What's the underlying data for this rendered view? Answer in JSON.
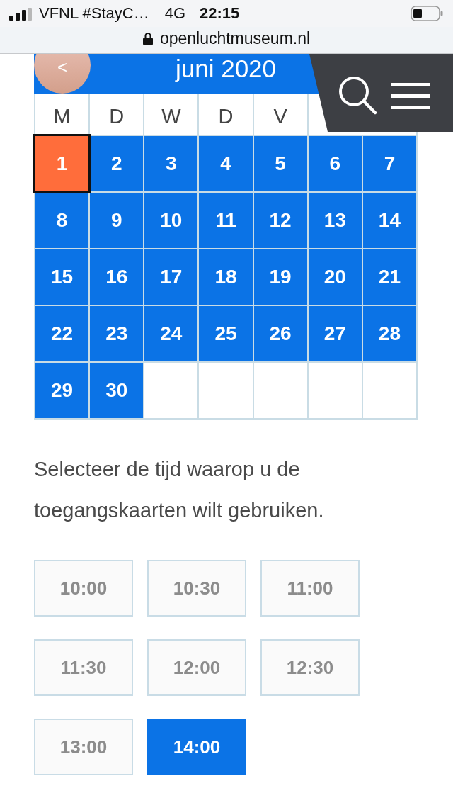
{
  "status_bar": {
    "carrier": "VFNL #StayC…",
    "network": "4G",
    "time": "22:15"
  },
  "address_bar": {
    "url": "openluchtmuseum.nl"
  },
  "calendar": {
    "prev_button": "<",
    "month_title": "juni 2020",
    "weekdays": [
      "M",
      "D",
      "W",
      "D",
      "V"
    ],
    "days": [
      {
        "label": "1",
        "selected": true
      },
      {
        "label": "2",
        "selected": false
      },
      {
        "label": "3",
        "selected": false
      },
      {
        "label": "4",
        "selected": false
      },
      {
        "label": "5",
        "selected": false
      },
      {
        "label": "6",
        "selected": false
      },
      {
        "label": "7",
        "selected": false
      },
      {
        "label": "8",
        "selected": false
      },
      {
        "label": "9",
        "selected": false
      },
      {
        "label": "10",
        "selected": false
      },
      {
        "label": "11",
        "selected": false
      },
      {
        "label": "12",
        "selected": false
      },
      {
        "label": "13",
        "selected": false
      },
      {
        "label": "14",
        "selected": false
      },
      {
        "label": "15",
        "selected": false
      },
      {
        "label": "16",
        "selected": false
      },
      {
        "label": "17",
        "selected": false
      },
      {
        "label": "18",
        "selected": false
      },
      {
        "label": "19",
        "selected": false
      },
      {
        "label": "20",
        "selected": false
      },
      {
        "label": "21",
        "selected": false
      },
      {
        "label": "22",
        "selected": false
      },
      {
        "label": "23",
        "selected": false
      },
      {
        "label": "24",
        "selected": false
      },
      {
        "label": "25",
        "selected": false
      },
      {
        "label": "26",
        "selected": false
      },
      {
        "label": "27",
        "selected": false
      },
      {
        "label": "28",
        "selected": false
      },
      {
        "label": "29",
        "selected": false
      },
      {
        "label": "30",
        "selected": false
      }
    ]
  },
  "instruction": "Selecteer de tijd waarop u de toegangskaarten wilt gebruiken.",
  "times": [
    {
      "label": "10:00",
      "selected": false
    },
    {
      "label": "10:30",
      "selected": false
    },
    {
      "label": "11:00",
      "selected": false
    },
    {
      "label": "11:30",
      "selected": false
    },
    {
      "label": "12:00",
      "selected": false
    },
    {
      "label": "12:30",
      "selected": false
    },
    {
      "label": "13:00",
      "selected": false
    },
    {
      "label": "14:00",
      "selected": true
    }
  ]
}
